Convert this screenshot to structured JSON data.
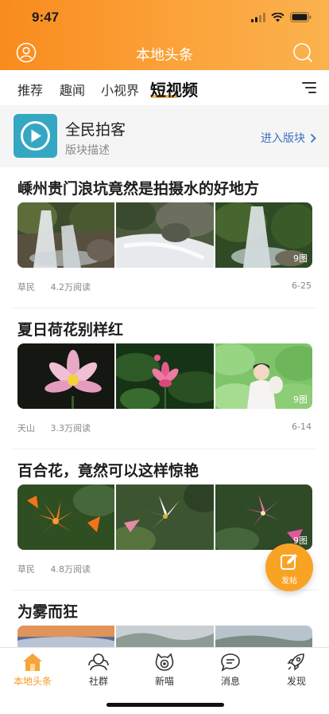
{
  "status": {
    "time": "9:47"
  },
  "nav": {
    "title": "本地头条"
  },
  "tabs": [
    {
      "label": "推荐"
    },
    {
      "label": "趣闻"
    },
    {
      "label": "小视界"
    },
    {
      "label": "短视频"
    }
  ],
  "block": {
    "title": "全民拍客",
    "desc": "版块描述",
    "enter": "进入版块"
  },
  "articles": [
    {
      "title": "嵊州贵门浪坑竟然是拍摄水的好地方",
      "author": "草民",
      "reads": "4.2万阅读",
      "date": "6-25",
      "count": "9图"
    },
    {
      "title": "夏日荷花别样红",
      "author": "天山",
      "reads": "3.3万阅读",
      "date": "6-14",
      "count": "9图"
    },
    {
      "title": "百合花，竟然可以这样惊艳",
      "author": "草民",
      "reads": "4.8万阅读",
      "date": "",
      "count": "9图"
    },
    {
      "title": "为雾而狂"
    }
  ],
  "fab": {
    "label": "发帖",
    "icon": "edit-icon"
  },
  "tabbar": [
    {
      "label": "本地头条",
      "icon": "home-icon"
    },
    {
      "label": "社群",
      "icon": "community-icon"
    },
    {
      "label": "新喵",
      "icon": "cat-icon"
    },
    {
      "label": "消息",
      "icon": "message-icon"
    },
    {
      "label": "发现",
      "icon": "rocket-icon"
    }
  ],
  "colors": {
    "accent": "#f9a324",
    "link": "#3a73c2",
    "block_logo": "#34a7c3"
  }
}
